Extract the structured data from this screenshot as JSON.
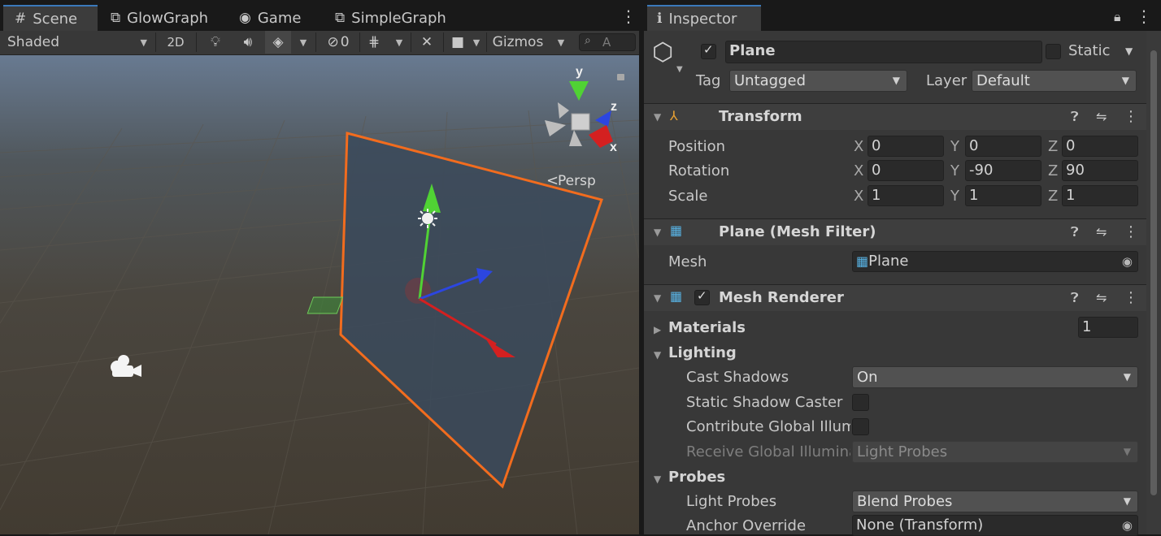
{
  "scene_panel": {
    "tabs": [
      {
        "label": "Scene",
        "icon": "grid-icon",
        "active": true
      },
      {
        "label": "GlowGraph",
        "icon": "graph-node-icon",
        "active": false
      },
      {
        "label": "Game",
        "icon": "gamepad-icon",
        "active": false
      },
      {
        "label": "SimpleGraph",
        "icon": "graph-node-icon",
        "active": false
      }
    ],
    "toolbar": {
      "shading_mode": "Shaded",
      "mode_2d": "2D",
      "hidden_count": "0",
      "gizmos_label": "Gizmos",
      "search_placeholder": "A"
    },
    "viewport": {
      "projection_label": "Persp",
      "gizmo_axes": {
        "x": "x",
        "y": "y",
        "z": "z"
      }
    }
  },
  "inspector": {
    "tab_label": "Inspector",
    "object": {
      "name": "Plane",
      "active": true,
      "static_label": "Static",
      "static_checked": false,
      "tag_label": "Tag",
      "tag_value": "Untagged",
      "layer_label": "Layer",
      "layer_value": "Default"
    },
    "transform": {
      "title": "Transform",
      "rows": [
        {
          "label": "Position",
          "x": "0",
          "y": "0",
          "z": "0"
        },
        {
          "label": "Rotation",
          "x": "0",
          "y": "-90",
          "z": "90"
        },
        {
          "label": "Scale",
          "x": "1",
          "y": "1",
          "z": "1"
        }
      ],
      "axis_labels": {
        "x": "X",
        "y": "Y",
        "z": "Z"
      }
    },
    "mesh_filter": {
      "title": "Plane (Mesh Filter)",
      "mesh_label": "Mesh",
      "mesh_value": "Plane"
    },
    "mesh_renderer": {
      "title": "Mesh Renderer",
      "enabled": true,
      "materials_label": "Materials",
      "materials_count": "1",
      "lighting_label": "Lighting",
      "cast_shadows_label": "Cast Shadows",
      "cast_shadows_value": "On",
      "static_shadow_caster_label": "Static Shadow Caster",
      "contribute_gi_label": "Contribute Global Illumi",
      "receive_gi_label": "Receive Global Illumina",
      "receive_gi_value": "Light Probes",
      "probes_label": "Probes",
      "light_probes_label": "Light Probes",
      "light_probes_value": "Blend Probes",
      "anchor_override_label": "Anchor Override",
      "anchor_override_value": "None (Transform)"
    }
  },
  "colors": {
    "selection_outline": "#f26c1e",
    "axis_x": "#d42020",
    "axis_y": "#50d234",
    "axis_z": "#2c46e0",
    "tab_accent": "#3a79bb"
  }
}
